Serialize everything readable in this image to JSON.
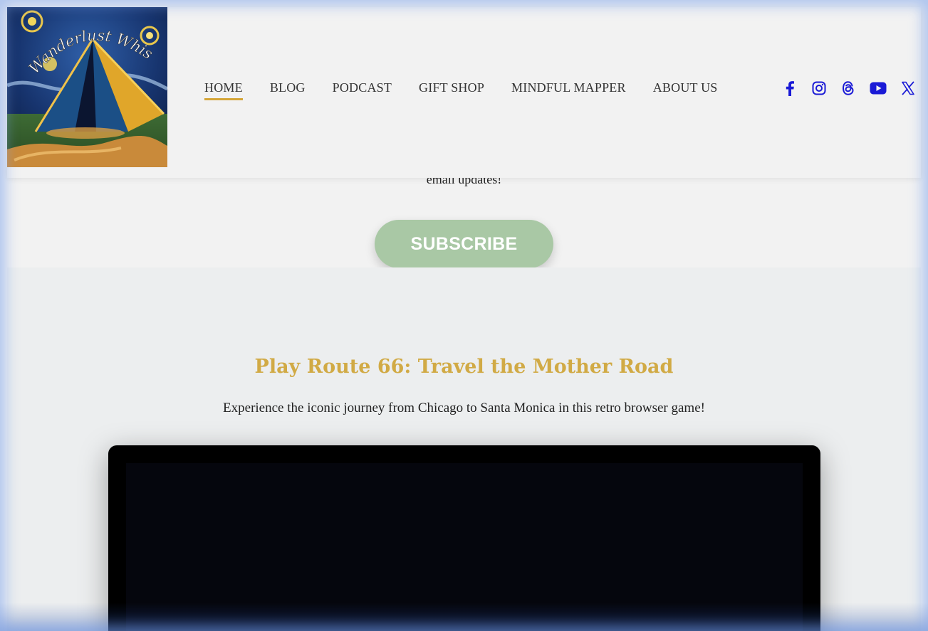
{
  "header": {
    "logo_text": "Wanderlust Whisperz",
    "nav": [
      {
        "label": "HOME",
        "active": true
      },
      {
        "label": "BLOG",
        "active": false
      },
      {
        "label": "PODCAST",
        "active": false
      },
      {
        "label": "GIFT SHOP",
        "active": false
      },
      {
        "label": "MINDFUL MAPPER",
        "active": false
      },
      {
        "label": "ABOUT US",
        "active": false
      }
    ],
    "social": [
      "facebook-icon",
      "instagram-icon",
      "threads-icon",
      "youtube-icon",
      "x-icon"
    ],
    "accent_color": "#d4a537",
    "social_color": "#1a1ad6"
  },
  "subscribe": {
    "text": "email updates!",
    "button_label": "SUBSCRIBE",
    "button_color": "#a9c8a5"
  },
  "game": {
    "title": "Play Route 66: Travel the Mother Road",
    "description": "Experience the iconic journey from Chicago to Santa Monica in this retro browser game!",
    "title_color": "#d1aa45"
  }
}
